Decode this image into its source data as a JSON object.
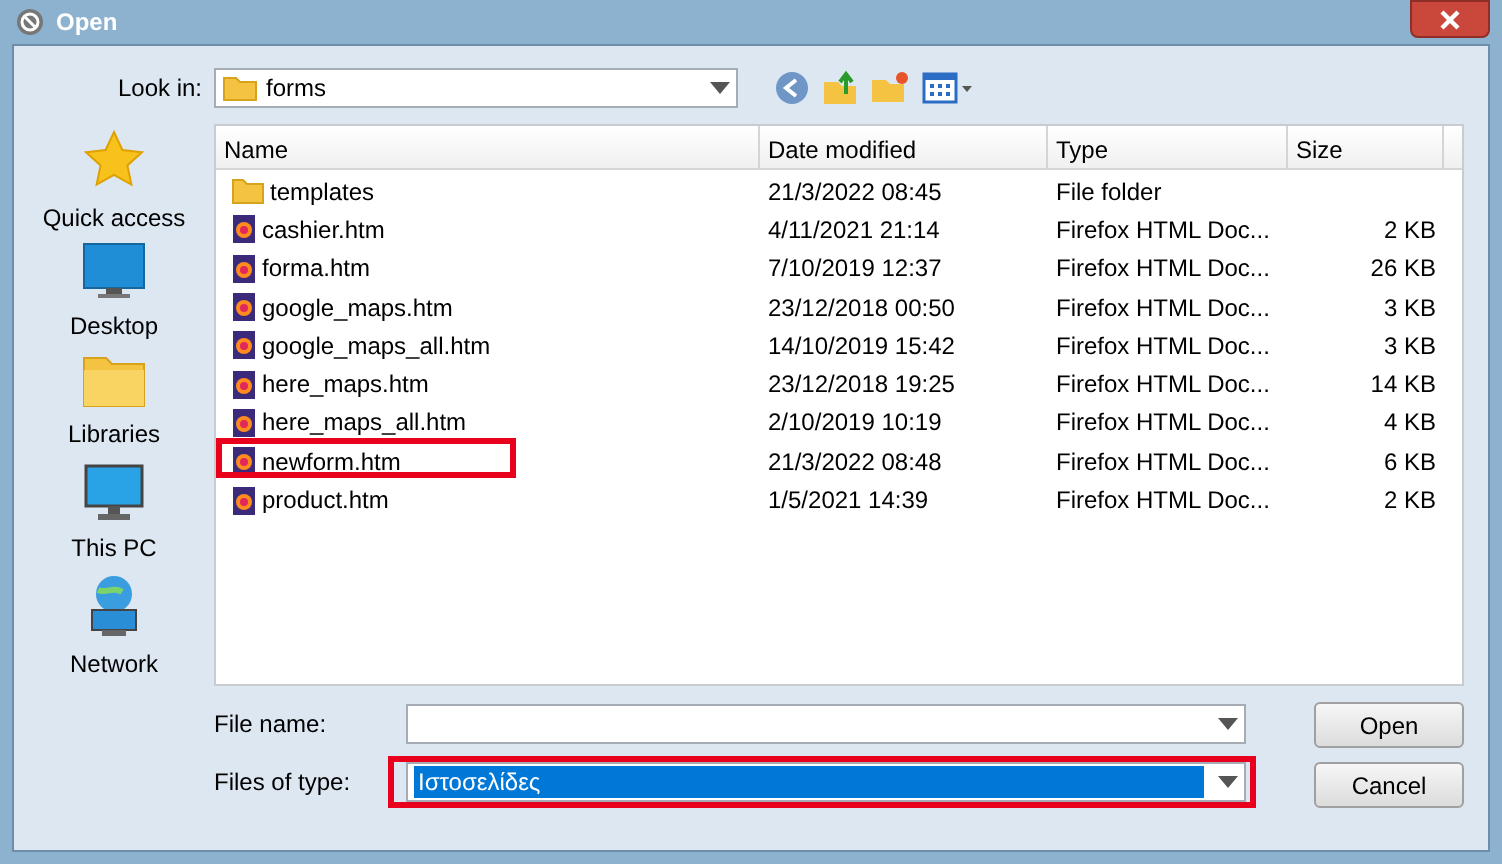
{
  "window": {
    "title": "Open"
  },
  "look_in": {
    "label": "Look in:",
    "value": "forms"
  },
  "sidebar": {
    "items": [
      {
        "label": "Quick access",
        "kind": "star"
      },
      {
        "label": "Desktop",
        "kind": "desktop"
      },
      {
        "label": "Libraries",
        "kind": "folder"
      },
      {
        "label": "This PC",
        "kind": "pc"
      },
      {
        "label": "Network",
        "kind": "network"
      }
    ]
  },
  "table": {
    "columns": [
      "Name",
      "Date modified",
      "Type",
      "Size"
    ],
    "rows": [
      {
        "kind": "folder",
        "name": "templates",
        "date": "21/3/2022 08:45",
        "type": "File folder",
        "highlighted": false
      },
      {
        "kind": "file",
        "name": "cashier.htm",
        "date": "4/11/2021 21:14",
        "type": "Firefox HTML Doc...",
        "size": "2 KB",
        "highlighted": false
      },
      {
        "kind": "file",
        "name": "forma.htm",
        "date": "7/10/2019 12:37",
        "type": "Firefox HTML Doc...",
        "size": "26 KB",
        "highlighted": false
      },
      {
        "kind": "file",
        "name": "google_maps.htm",
        "date": "23/12/2018 00:50",
        "type": "Firefox HTML Doc...",
        "size": "3 KB",
        "highlighted": false
      },
      {
        "kind": "file",
        "name": "google_maps_all.htm",
        "date": "14/10/2019 15:42",
        "type": "Firefox HTML Doc...",
        "size": "3 KB",
        "highlighted": false
      },
      {
        "kind": "file",
        "name": "here_maps.htm",
        "date": "23/12/2018 19:25",
        "type": "Firefox HTML Doc...",
        "size": "14 KB",
        "highlighted": false
      },
      {
        "kind": "file",
        "name": "here_maps_all.htm",
        "date": "2/10/2019 10:19",
        "type": "Firefox HTML Doc...",
        "size": "4 KB",
        "highlighted": false
      },
      {
        "kind": "file",
        "name": "newform.htm",
        "date": "21/3/2022 08:48",
        "type": "Firefox HTML Doc...",
        "size": "6 KB",
        "highlighted": true
      },
      {
        "kind": "file",
        "name": "product.htm",
        "date": "1/5/2021 14:39",
        "type": "Firefox HTML Doc...",
        "size": "2 KB",
        "highlighted": false
      }
    ]
  },
  "file_name": {
    "label": "File name:"
  },
  "files_of_type": {
    "label": "Files of type:",
    "value": "Ιστοσελίδες",
    "selected": true,
    "highlighted": true
  },
  "buttons": [
    "Open",
    "Cancel"
  ]
}
